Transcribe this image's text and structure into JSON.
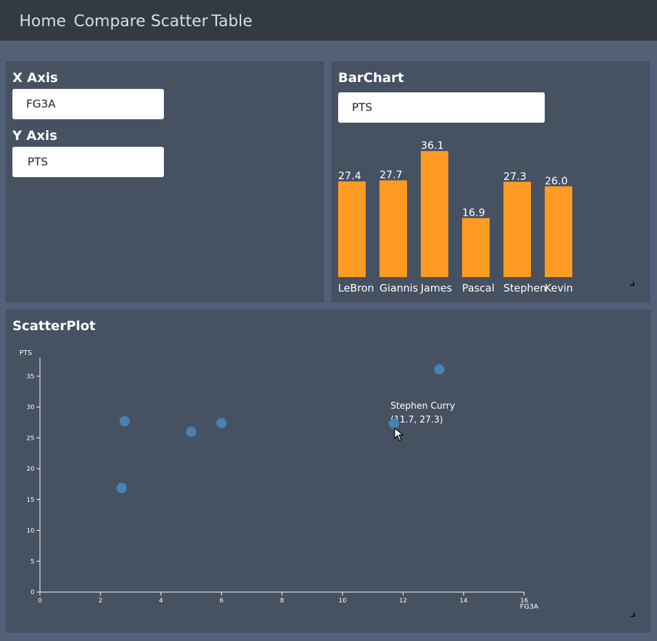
{
  "nav": {
    "items": [
      {
        "label": "Home"
      },
      {
        "label": "Compare"
      },
      {
        "label": "Scatter"
      },
      {
        "label": "Table"
      }
    ]
  },
  "axis_panel": {
    "x_title": "X Axis",
    "x_value": "FG3A",
    "y_title": "Y Axis",
    "y_value": "PTS"
  },
  "bar_panel": {
    "title": "BarChart",
    "select_value": "PTS"
  },
  "scatter_panel": {
    "title": "ScatterPlot",
    "tooltip_name": "Stephen Curry",
    "tooltip_coords": "(11.7, 27.3)"
  },
  "colors": {
    "bar": "#ff9a22",
    "point": "#4682b4",
    "panel": "#465162",
    "background": "#526078",
    "navbar": "#343a44"
  },
  "chart_data": [
    {
      "type": "bar",
      "categories": [
        "LeBron",
        "Giannis",
        "James",
        "Pascal",
        "Stephen",
        "Kevin"
      ],
      "values": [
        27.4,
        27.7,
        36.1,
        16.9,
        27.3,
        26.0
      ],
      "value_labels": [
        "27.4",
        "27.7",
        "36.1",
        "16.9",
        "27.3",
        "26.0"
      ],
      "ylim": [
        0,
        40
      ]
    },
    {
      "type": "scatter",
      "xlabel": "FG3A",
      "ylabel": "PTS",
      "xlim": [
        0,
        16
      ],
      "ylim": [
        0,
        38
      ],
      "x_ticks": [
        0,
        2,
        4,
        6,
        8,
        10,
        12,
        14,
        16
      ],
      "y_ticks": [
        0,
        5,
        10,
        15,
        20,
        25,
        30,
        35
      ],
      "points": [
        {
          "x": 2.8,
          "y": 27.7
        },
        {
          "x": 2.7,
          "y": 16.9
        },
        {
          "x": 5.0,
          "y": 26.0
        },
        {
          "x": 6.0,
          "y": 27.4
        },
        {
          "x": 11.7,
          "y": 27.3
        },
        {
          "x": 13.2,
          "y": 36.1
        }
      ]
    }
  ]
}
